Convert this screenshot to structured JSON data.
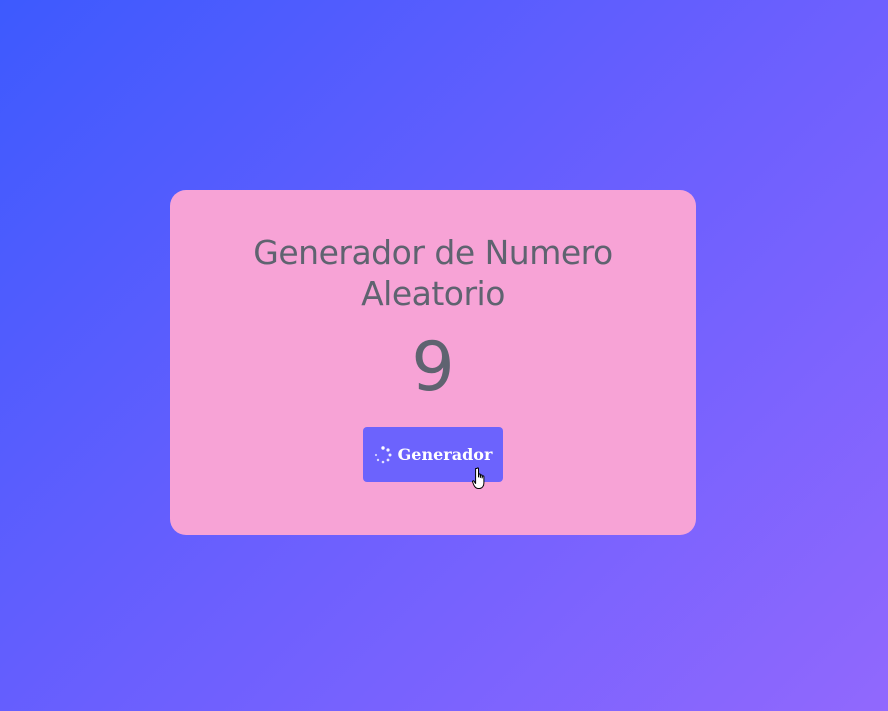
{
  "card": {
    "title": "Generador de Numero Aleatorio",
    "number": "9",
    "button_label": "Generador",
    "button_icon": "spinner-icon"
  },
  "colors": {
    "background_start": "#3d5afe",
    "background_end": "#9168fd",
    "card_background": "#f7a3d6",
    "text": "#5f6370",
    "button_background": "#6c63fd",
    "button_text": "#ffffff"
  }
}
